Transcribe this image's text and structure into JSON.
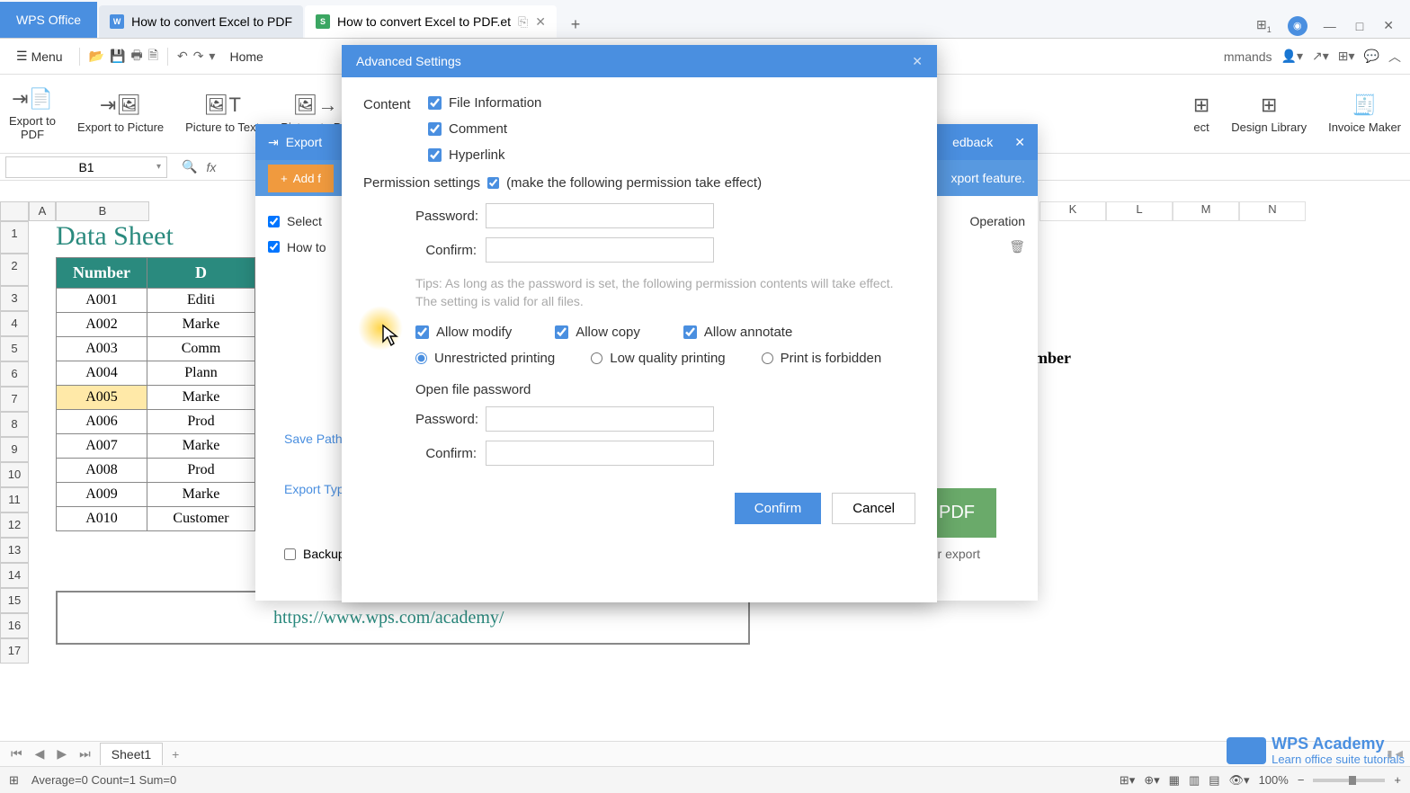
{
  "titlebar": {
    "app_name": "WPS Office",
    "tabs": [
      {
        "label": "How to convert Excel to PDF",
        "icon": "W"
      },
      {
        "label": "How to convert Excel to PDF.et",
        "icon": "S"
      }
    ],
    "win": {
      "dropdown": "▾",
      "min": "—",
      "max": "□",
      "close": "✕"
    }
  },
  "menubar": {
    "menu_label": "Menu",
    "home_label": "Home",
    "commands_visible": "mmands"
  },
  "ribbon": {
    "items": [
      {
        "label": "Export to\nPDF"
      },
      {
        "label": "Export to Picture"
      },
      {
        "label": "Picture to Text"
      },
      {
        "label": "Picture to PD"
      },
      {
        "label": "ect"
      },
      {
        "label": "Design Library"
      },
      {
        "label": "Invoice Maker"
      }
    ]
  },
  "formula": {
    "name_box": "B1",
    "fx": "fx"
  },
  "grid": {
    "cols_left": [
      "A",
      "B"
    ],
    "cols_right": [
      "K",
      "L",
      "M",
      "N"
    ],
    "rows": [
      "1",
      "2",
      "3",
      "4",
      "5",
      "6",
      "7",
      "8",
      "9",
      "10",
      "11",
      "12",
      "13",
      "14",
      "15",
      "16",
      "17"
    ]
  },
  "data_sheet": {
    "title": "Data Sheet",
    "headers": [
      "Number",
      "D"
    ],
    "rows": [
      [
        "A001",
        "Editi"
      ],
      [
        "A002",
        "Marke"
      ],
      [
        "A003",
        "Comm"
      ],
      [
        "A004",
        "Plann"
      ],
      [
        "A005",
        "Marke"
      ],
      [
        "A006",
        "Prod"
      ],
      [
        "A007",
        "Marke"
      ],
      [
        "A008",
        "Prod"
      ],
      [
        "A009",
        "Marke"
      ],
      [
        "A010",
        "Customer"
      ]
    ],
    "nber_visible": "mber",
    "url": "https://www.wps.com/academy/"
  },
  "export_dialog": {
    "title": "Export",
    "notice_right": "xport feature.",
    "notice_feedback": "edback",
    "add_file": "Add f",
    "select": "Select",
    "row_label": "How to",
    "operation": "Operation",
    "save_path": "Save Path",
    "export_type": "Export Typ",
    "backup": "Backup",
    "to_pdf": "o PDF",
    "or_export": "or export"
  },
  "advanced": {
    "title": "Advanced Settings",
    "content_label": "Content",
    "file_info": "File Information",
    "comment": "Comment",
    "hyperlink": "Hyperlink",
    "perm_label": "Permission settings",
    "perm_paren": "(make the following permission take effect)",
    "password_label": "Password:",
    "confirm_label": "Confirm:",
    "tip": "Tips: As long as the password is set, the following permission contents will take effect. The setting is valid for all files.",
    "allow_modify": "Allow modify",
    "allow_copy": "Allow copy",
    "allow_annotate": "Allow annotate",
    "print_unrestricted": "Unrestricted printing",
    "print_low": "Low quality printing",
    "print_forbidden": "Print is forbidden",
    "open_pw": "Open file password",
    "confirm_btn": "Confirm",
    "cancel_btn": "Cancel"
  },
  "sheet_tabs": {
    "active": "Sheet1"
  },
  "statusbar": {
    "stats": "Average=0  Count=1  Sum=0",
    "zoom": "100%"
  },
  "branding": {
    "name": "WPS Academy",
    "sub": "Learn office suite tutorials"
  }
}
